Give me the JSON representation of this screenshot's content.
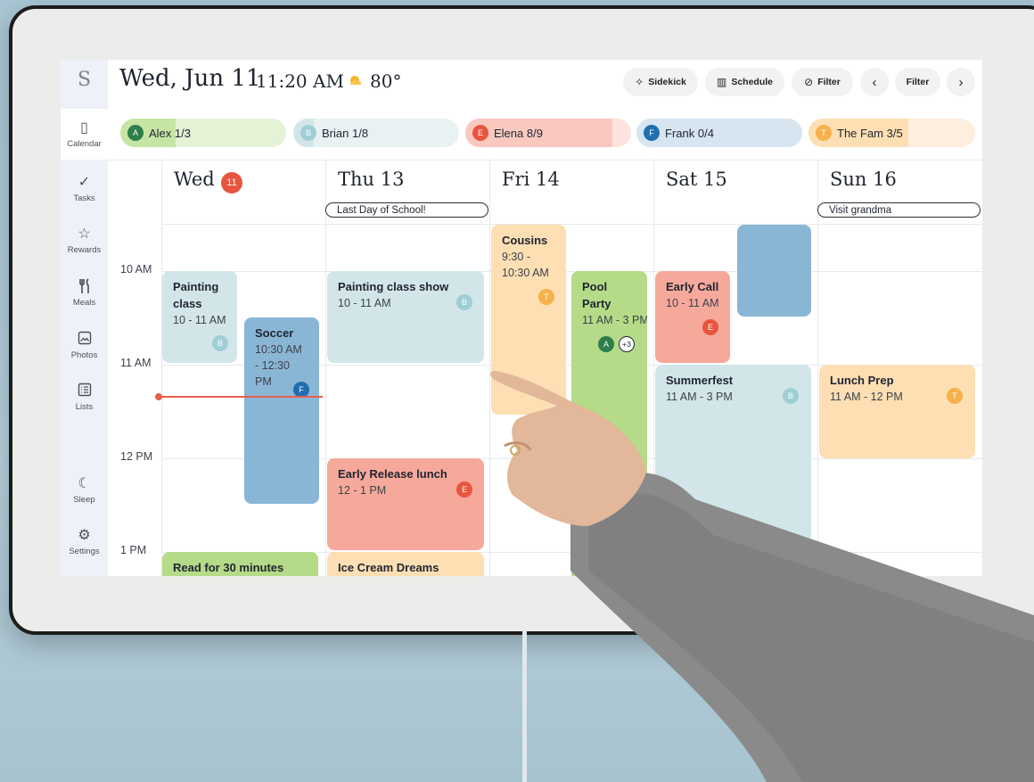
{
  "app": {
    "logo_letter": "S"
  },
  "header": {
    "date": "Wed, Jun 11",
    "time": "11:20 AM",
    "temperature": "80°",
    "weather_icon": "sun-cloud-icon",
    "buttons": {
      "sidekick": "Sidekick",
      "schedule": "Schedule",
      "filter": "Filter",
      "filter2": "Filter"
    }
  },
  "sidebar": {
    "items": [
      {
        "label": "Calendar",
        "icon": "calendar-icon",
        "glyph": "▯"
      },
      {
        "label": "Tasks",
        "icon": "check-icon",
        "glyph": "✓"
      },
      {
        "label": "Rewards",
        "icon": "star-icon",
        "glyph": "☆"
      },
      {
        "label": "Meals",
        "icon": "fork-knife-icon",
        "glyph": "🍴"
      },
      {
        "label": "Photos",
        "icon": "photo-icon",
        "glyph": "▣"
      },
      {
        "label": "Lists",
        "icon": "list-icon",
        "glyph": "☰"
      },
      {
        "label": "Sleep",
        "icon": "moon-icon",
        "glyph": "☾"
      },
      {
        "label": "Settings",
        "icon": "gear-icon",
        "glyph": "⚙"
      }
    ]
  },
  "members": [
    {
      "initial": "A",
      "name": "Alex",
      "progress": "1/3",
      "done": 1,
      "total": 3,
      "color": "#2e7d4a",
      "bg": "#e4f2d5",
      "fill": "#c6e5a4"
    },
    {
      "initial": "B",
      "name": "Brian",
      "progress": "1/8",
      "done": 1,
      "total": 8,
      "color": "#9fcfd4",
      "bg": "#e8f2f3",
      "fill": "#d2e6e9"
    },
    {
      "initial": "E",
      "name": "Elena",
      "progress": "8/9",
      "done": 8,
      "total": 9,
      "color": "#e8553f",
      "bg": "#fde3de",
      "fill": "#f9c9c0"
    },
    {
      "initial": "F",
      "name": "Frank",
      "progress": "0/4",
      "done": 0,
      "total": 4,
      "color": "#1f6fae",
      "bg": "#d6e5f0",
      "fill": "#d6e5f0"
    },
    {
      "initial": "T",
      "name": "The Fam",
      "progress": "3/5",
      "done": 3,
      "total": 5,
      "color": "#f6b14c",
      "bg": "#fdeedd",
      "fill": "#fddfb3"
    }
  ],
  "days": [
    {
      "label": "Wed",
      "badge": "11"
    },
    {
      "label": "Thu 13",
      "all_day": "Last Day of School!"
    },
    {
      "label": "Fri 14"
    },
    {
      "label": "Sat 15"
    },
    {
      "label": "Sun 16",
      "all_day": "Visit grandma"
    }
  ],
  "time_labels": [
    "10 AM",
    "11 AM",
    "12 PM",
    "1 PM"
  ],
  "events": {
    "painting_class": {
      "title": "Painting class",
      "time": "10 - 11 AM",
      "avatar": "B"
    },
    "soccer": {
      "title": "Soccer",
      "time": "10:30 AM - 12:30 PM",
      "avatar": "F"
    },
    "read": {
      "title": "Read for 30 minutes"
    },
    "painting_show": {
      "title": "Painting class show",
      "time": "10 - 11 AM",
      "avatar": "B"
    },
    "early_release": {
      "title": "Early Release lunch",
      "time": "12 - 1 PM",
      "avatar": "E"
    },
    "ice_cream": {
      "title": "Ice Cream Dreams"
    },
    "cousins": {
      "title": "Cousins",
      "time": "9:30 - 10:30 AM",
      "avatar": "T"
    },
    "pool_party": {
      "title": "Pool Party",
      "time": "11 AM - 3 PM",
      "avatar": "A",
      "more": "+3"
    },
    "early_call": {
      "title": "Early Call",
      "time": "10 - 11 AM",
      "avatar": "E"
    },
    "summerfest": {
      "title": "Summerfest",
      "time": "11 AM - 3 PM",
      "avatar": "B"
    },
    "lunch_prep": {
      "title": "Lunch Prep",
      "time": "11 AM - 12 PM",
      "avatar": "T"
    }
  }
}
